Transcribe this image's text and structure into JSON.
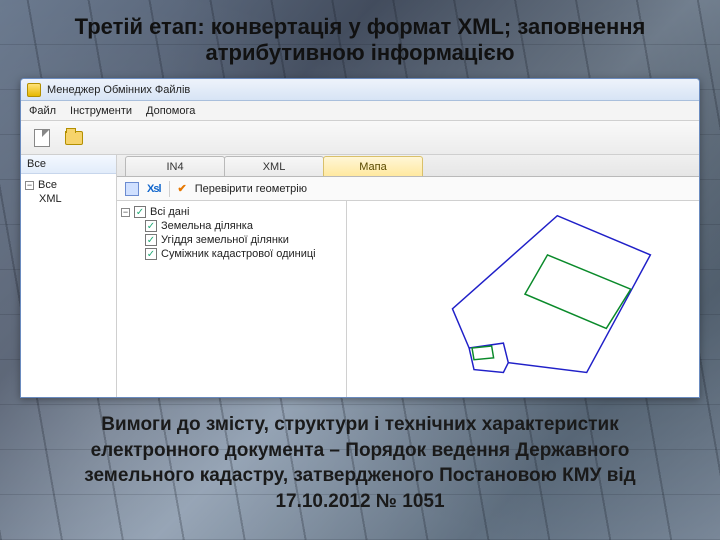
{
  "slide": {
    "title": "Третій етап: конвертація у формат XML; заповнення атрибутивною інформацією",
    "footer": "Вимоги до змісту, структури і технічних характеристик електронного документа – Порядок ведення Державного земельного кадастру, затвердженого Постановою КМУ від 17.10.2012 № 1051"
  },
  "window": {
    "title": "Менеджер Обмінних Файлів",
    "menu": {
      "file": "Файл",
      "tools": "Інструменти",
      "help": "Допомога"
    },
    "left_panel_header": "Все",
    "left_tree_root": "XML",
    "tabs": {
      "in4": "IN4",
      "xml": "XML",
      "map": "Мапа"
    },
    "validate_label": "Перевірити геометрію",
    "layers": {
      "root": "Всі дані",
      "l1": "Земельна ділянка",
      "l2": "Угіддя земельної ділянки",
      "l3": "Суміжник кадастрової одиниці"
    }
  }
}
